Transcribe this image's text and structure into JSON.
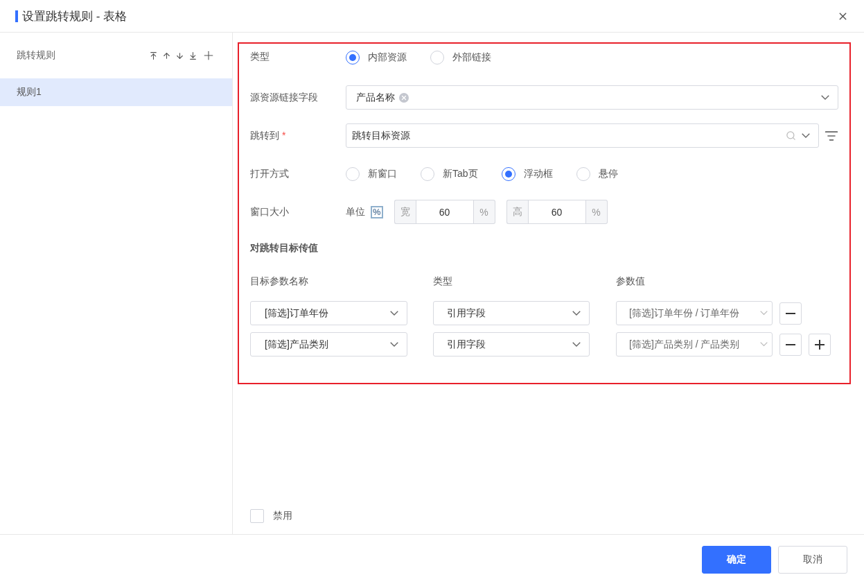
{
  "dialog": {
    "title": "设置跳转规则 - 表格"
  },
  "sidebar": {
    "title": "跳转规则",
    "rules": [
      {
        "label": "规则1",
        "selected": true
      }
    ]
  },
  "form": {
    "type": {
      "label": "类型",
      "options": [
        {
          "label": "内部资源",
          "selected": true
        },
        {
          "label": "外部链接",
          "selected": false
        }
      ]
    },
    "source_field": {
      "label": "源资源链接字段",
      "tags": [
        "产品名称"
      ]
    },
    "target": {
      "label": "跳转到",
      "required_mark": "*",
      "value": "跳转目标资源"
    },
    "open_mode": {
      "label": "打开方式",
      "options": [
        {
          "label": "新窗口",
          "selected": false
        },
        {
          "label": "新Tab页",
          "selected": false
        },
        {
          "label": "浮动框",
          "selected": true
        },
        {
          "label": "悬停",
          "selected": false
        }
      ]
    },
    "window_size": {
      "label": "窗口大小",
      "unit_label": "单位",
      "unit_symbol": "%",
      "fields": [
        {
          "prefix": "宽",
          "value": "60",
          "suffix": "%"
        },
        {
          "prefix": "高",
          "value": "60",
          "suffix": "%"
        }
      ]
    },
    "params": {
      "title": "对跳转目标传值",
      "columns": [
        "目标参数名称",
        "类型",
        "参数值"
      ],
      "rows": [
        {
          "name": "[筛选]订单年份",
          "type": "引用字段",
          "value": "[筛选]订单年份 / 订单年份"
        },
        {
          "name": "[筛选]产品类别",
          "type": "引用字段",
          "value": "[筛选]产品类别 / 产品类别"
        }
      ]
    }
  },
  "disable": {
    "label": "禁用",
    "checked": false
  },
  "buttons": [
    {
      "label": "确定",
      "kind": "primary"
    },
    {
      "label": "取消",
      "kind": "default"
    }
  ]
}
